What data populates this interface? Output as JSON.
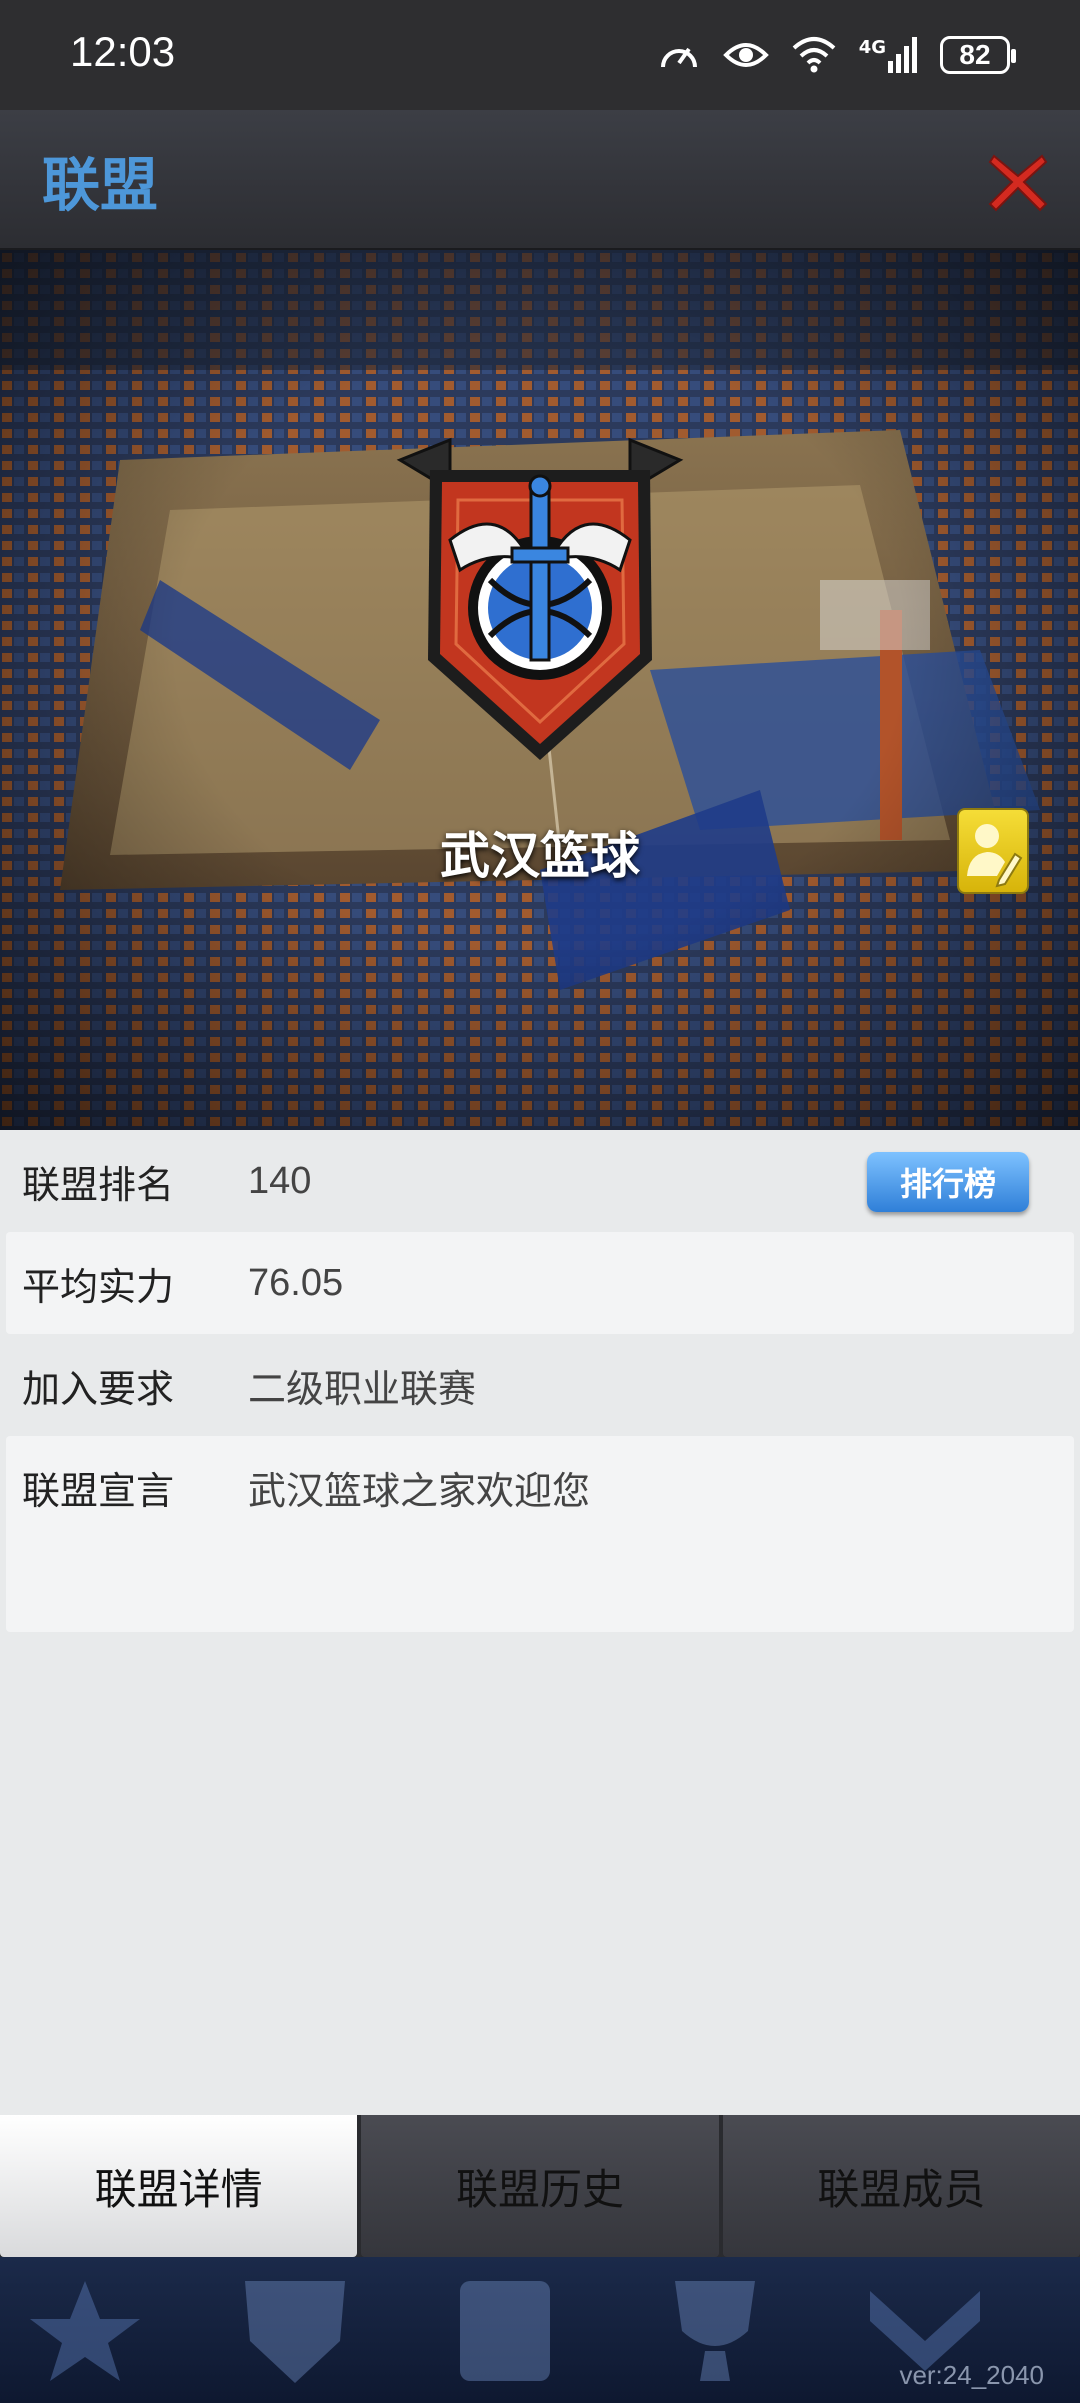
{
  "status_bar": {
    "time": "12:03",
    "network": "4G",
    "battery": "82"
  },
  "header": {
    "title": "联盟"
  },
  "alliance": {
    "name": "武汉篮球"
  },
  "info": {
    "rank_label": "联盟排名",
    "rank_value": "140",
    "ranking_button": "排行榜",
    "strength_label": "平均实力",
    "strength_value": "76.05",
    "requirement_label": "加入要求",
    "requirement_value": "二级职业联赛",
    "declaration_label": "联盟宣言",
    "declaration_value": "武汉篮球之家欢迎您"
  },
  "tabs": [
    {
      "label": "联盟详情",
      "active": true
    },
    {
      "label": "联盟历史",
      "active": false
    },
    {
      "label": "联盟成员",
      "active": false
    }
  ],
  "footer": {
    "version": "ver:24_2040"
  },
  "colors": {
    "title_blue": "#4d97d9",
    "close_red": "#d42a20",
    "emblem_red": "#c2361f",
    "button_blue": "#2f7fd8",
    "edit_yellow": "#f5dd37"
  }
}
